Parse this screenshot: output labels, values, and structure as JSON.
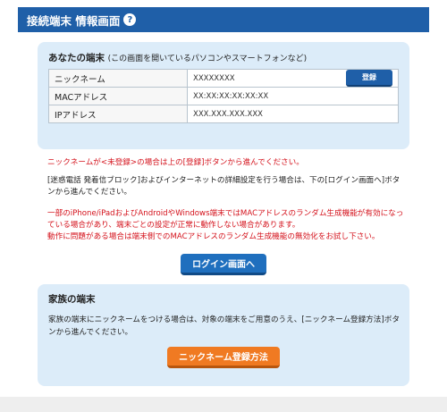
{
  "header": {
    "title": "接続端末 情報画面",
    "help_icon": "?"
  },
  "device_panel": {
    "title": "あなたの端末",
    "subtitle": "(この画面を開いているパソコンやスマートフォンなど)",
    "rows": [
      {
        "label": "ニックネーム",
        "value": "XXXXXXXX"
      },
      {
        "label": "MACアドレス",
        "value": "XX:XX:XX:XX:XX:XX"
      },
      {
        "label": "IPアドレス",
        "value": "XXX.XXX.XXX.XXX"
      }
    ],
    "register_button": "登録"
  },
  "notes": {
    "unregistered": "ニックネームが<未登録>の場合は上の[登録]ボタンから進んでください。",
    "settings": "[迷惑電話 発着信ブロック]およびインターネットの詳細設定を行う場合は、下の[ログイン画面へ]ボタンから進んでください。",
    "mac_warning_1": "一部のiPhone/iPadおよびAndroidやWindows端末ではMACアドレスのランダム生成機能が有効になっている場合があり、端末ごとの設定が正常に動作しない場合があります。",
    "mac_warning_2": "動作に問題がある場合は端末側でのMACアドレスのランダム生成機能の無効化をお試し下さい。"
  },
  "login_button": "ログイン画面へ",
  "family_panel": {
    "title": "家族の端末",
    "text": "家族の端末にニックネームをつける場合は、対象の端末をご用意のうえ、[ニックネーム登録方法]ボタンから進んでください。",
    "button": "ニックネーム登録方法"
  },
  "colors": {
    "header": "#1f5fa8",
    "panel": "#dcecf9",
    "warning": "#d4111b",
    "orange_button": "#f07a22"
  }
}
